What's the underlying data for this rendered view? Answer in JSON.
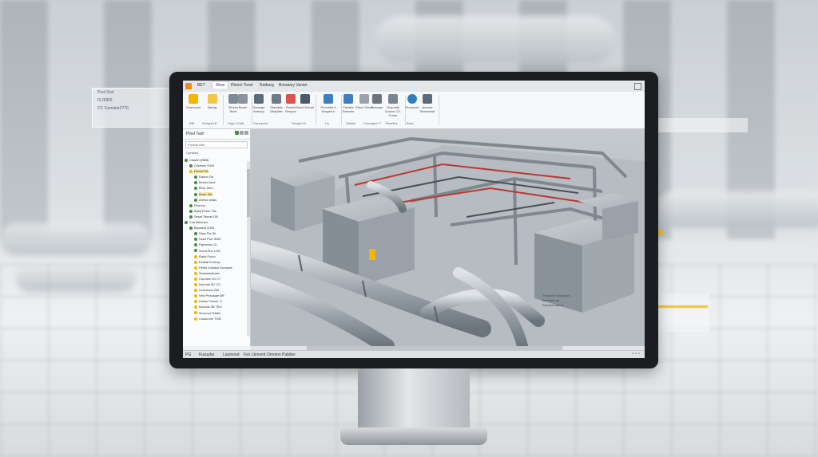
{
  "background": {
    "card_lines": [
      "Pool Sort",
      "IS 00DS",
      "CC Carnelor2770"
    ]
  },
  "app": {
    "tabs": [
      "BET",
      "Shox",
      "Pbrect Toxet",
      "Ratburg",
      "Bonatary Vanter"
    ],
    "active_tab_index": 1,
    "ribbon_buttons": [
      {
        "label": "Communit",
        "icon": "cube-icon",
        "color": "#f2b705"
      },
      {
        "label": "Berlap",
        "icon": "folder-icon",
        "color": "#f3c74a"
      },
      {
        "label": "Stecho Sivel",
        "icon": "pipe-icon",
        "color": "#7d8a96"
      },
      {
        "label": "Bosel",
        "icon": "fitting-icon",
        "color": "#8a939c"
      },
      {
        "label": "Daneige Arelaop",
        "icon": "wrench-icon",
        "color": "#5b6b79"
      },
      {
        "label": "Standide Distplaie",
        "icon": "duct-icon",
        "color": "#6e7a85"
      },
      {
        "label": "Rooldt Respon",
        "icon": "tag-icon",
        "color": "#d9534f"
      },
      {
        "label": "Bruid Dstold",
        "icon": "valve-icon",
        "color": "#4a5a68"
      },
      {
        "label": "Pornultet Ii Sosgert Ir",
        "icon": "connect-icon",
        "color": "#3d7fc1"
      },
      {
        "label": "Fariaite Saesein",
        "icon": "link-icon",
        "color": "#3d7fc1"
      },
      {
        "label": "Shew Obhel",
        "icon": "layer-icon",
        "color": "#9aa3ab"
      },
      {
        "label": "Tracepe",
        "icon": "trace-icon",
        "color": "#6b7680"
      },
      {
        "label": "Ousontly Cunixe CX-Corse",
        "icon": "settings-icon",
        "color": "#7a858f"
      },
      {
        "label": "Punwend",
        "icon": "search-icon",
        "color": "#2f7dbd"
      },
      {
        "label": "Iserestr Bessertad",
        "icon": "view-icon",
        "color": "#5b6b79"
      }
    ],
    "ribbon_groups": [
      "BBI",
      "Sengdel B",
      "Srgto Chaft",
      "Gannemts",
      "Sengkrtl II",
      "Lls",
      "Saesie",
      "Comegtorr T",
      "Baretihs",
      "Bred"
    ],
    "panel": {
      "title": "Pinel Tadt",
      "search_placeholder": "Pomisit Blat",
      "sub_label": "Cprsltsiy",
      "tree_items": [
        {
          "label": "Clasbrt (BBB)",
          "bullet": "#4a8c3f",
          "indent": 0
        },
        {
          "label": "Creewer 0000",
          "bullet": "#4a8c3f",
          "indent": 1
        },
        {
          "label": "Eeusd Elk",
          "bullet": "#f2b705",
          "indent": 1,
          "highlight": true
        },
        {
          "label": "Dactor Ge",
          "bullet": "#4a8c3f",
          "indent": 2
        },
        {
          "label": "Beeilo Abra",
          "bullet": "#4a8c3f",
          "indent": 2
        },
        {
          "label": "Bhur Sleo",
          "bullet": "#4a8c3f",
          "indent": 2
        },
        {
          "label": "Booe Silo",
          "bullet": "#4a8c3f",
          "indent": 2,
          "highlight": true
        },
        {
          "label": "Aretse sbtas",
          "bullet": "#4a8c3f",
          "indent": 2
        },
        {
          "label": "Etreons",
          "bullet": "#4a8c3f",
          "indent": 1
        },
        {
          "label": "Bastl Pheer Ols",
          "bullet": "#4a8c3f",
          "indent": 1
        },
        {
          "label": "Sesef Tseesf Oill",
          "bullet": "#4a8c3f",
          "indent": 1
        },
        {
          "label": "Cne Blunusn",
          "bullet": "#4a8c3f",
          "indent": 0
        },
        {
          "label": "Bsuwest 2300",
          "bullet": "#4a8c3f",
          "indent": 1
        },
        {
          "label": "Stsw Fla Sti",
          "bullet": "#4a8c3f",
          "indent": 2
        },
        {
          "label": "Sxan Poe 9000",
          "bullet": "#4a8c3f",
          "indent": 2
        },
        {
          "label": "Pgreenoc OI",
          "bullet": "#4a8c3f",
          "indent": 2
        },
        {
          "label": "Sorvs fine LGD",
          "bullet": "#4a8c3f",
          "indent": 2
        },
        {
          "label": "Ralot Forco",
          "bullet": "#f2b705",
          "indent": 2
        },
        {
          "label": "Exetial Eeobsy",
          "bullet": "#f2b705",
          "indent": 2
        },
        {
          "label": "Peetir Dalrase Eumiave",
          "bullet": "#f2b705",
          "indent": 2
        },
        {
          "label": "Sesestsslbase",
          "bullet": "#f2b705",
          "indent": 2
        },
        {
          "label": "Conoiee ICI CT",
          "bullet": "#f2b705",
          "indent": 2
        },
        {
          "label": "Deondo 6C CG",
          "bullet": "#f2b705",
          "indent": 2
        },
        {
          "label": "Leoenuce 260",
          "bullet": "#f2b705",
          "indent": 2
        },
        {
          "label": "Vew Pesoslae BR",
          "bullet": "#f2b705",
          "indent": 2
        },
        {
          "label": "Dower Tersce 7r",
          "bullet": "#f2b705",
          "indent": 2
        },
        {
          "label": "Boorsst 3B 7BG",
          "bullet": "#f2b705",
          "indent": 2
        },
        {
          "label": "Sinrnoce Bfdbe",
          "bullet": "#f2b705",
          "indent": 2
        },
        {
          "label": "Cuascone 7000",
          "bullet": "#f2b705",
          "indent": 2
        }
      ]
    },
    "viewport_annotation": [
      "Trzepeue Sausmes",
      "Beecstet oo",
      "Seruleel toleve"
    ],
    "statusbar": [
      "PG",
      "Fuxuyfar",
      "Lsomond",
      "Fsir Lbmsmt Omriem Pabliter"
    ]
  }
}
